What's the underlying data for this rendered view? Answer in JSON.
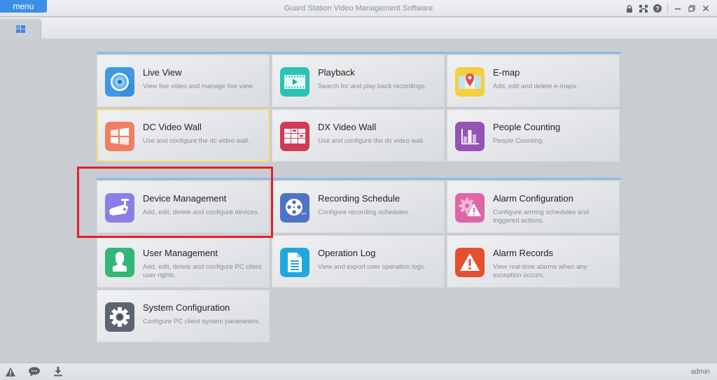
{
  "titlebar": {
    "menu_label": "menu",
    "app_title": "Guard Station Video Management Software",
    "controls": [
      "lock-icon",
      "network-icon",
      "help-icon",
      "minimize-icon",
      "restore-icon",
      "close-icon"
    ]
  },
  "tabbar": {
    "home_tab_icon": "grid-icon"
  },
  "tiles": [
    {
      "title": "Live View",
      "desc": "View live video and manage live view.",
      "icon": "camera-lens-icon",
      "color": "#3f98e3"
    },
    {
      "title": "Playback",
      "desc": "Search for and play back recordings.",
      "icon": "film-play-icon",
      "color": "#2cc2b3"
    },
    {
      "title": "E-map",
      "desc": "Add, edit and delete e-maps.",
      "icon": "map-pin-icon",
      "color": "#f5cf3c"
    },
    {
      "title": "DC Video Wall",
      "desc": "Use and configure the dc video wall.",
      "icon": "windows-wall-icon",
      "color": "#f07e62"
    },
    {
      "title": "DX Video Wall",
      "desc": "Use and configure the dx video wall.",
      "icon": "video-wall-grid-icon",
      "color": "#cf3b56"
    },
    {
      "title": "People Counting",
      "desc": "People Counting.",
      "icon": "bar-chart-icon",
      "color": "#9354b3"
    },
    {
      "title": "Device Management",
      "desc": "Add, edit, delete and configure devices.",
      "icon": "security-camera-icon",
      "color": "#8c7ee8"
    },
    {
      "title": "Recording Schedule",
      "desc": "Configure recording schedules.",
      "icon": "film-reel-icon",
      "color": "#4f72c9"
    },
    {
      "title": "Alarm Configuration",
      "desc": "Configure arming schedules and triggered actions.",
      "icon": "gear-warning-icon",
      "color": "#e064a8"
    },
    {
      "title": "User Management",
      "desc": "Add, edit, delete and configure PC client user rights.",
      "icon": "user-icon",
      "color": "#32b779"
    },
    {
      "title": "Operation Log",
      "desc": "View and export user operation logs.",
      "icon": "document-icon",
      "color": "#22a6e0"
    },
    {
      "title": "Alarm Records",
      "desc": "View real-time alarms when any exception occurs.",
      "icon": "warning-icon",
      "color": "#e5502f"
    },
    {
      "title": "System Configuration",
      "desc": "Configure PC client system parameters.",
      "icon": "gear-icon",
      "color": "#5c6470"
    }
  ],
  "selected_tile": "DC Video Wall",
  "highlighted_tile": "Device Management",
  "statusbar": {
    "icons": [
      "alarm-warning-icon",
      "message-icon",
      "download-icon"
    ],
    "user": "admin"
  }
}
